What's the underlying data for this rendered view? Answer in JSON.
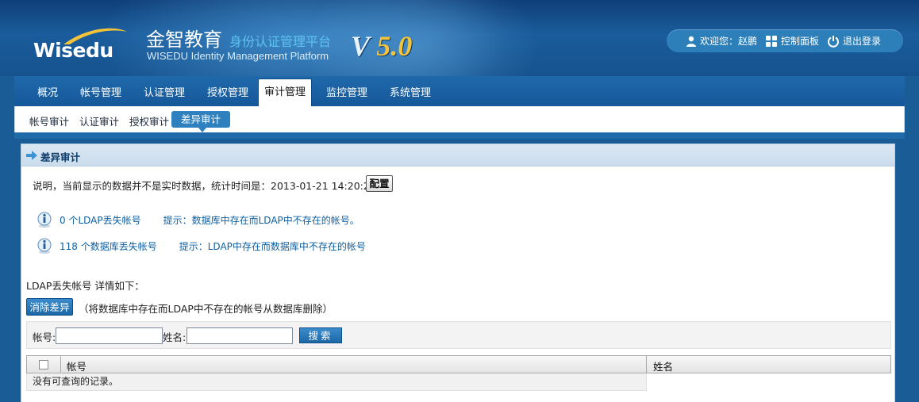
{
  "header": {
    "logo_text": "Wisedu",
    "brand_cn": "金智教育",
    "brand_sub": "身份认证管理平台",
    "brand_en": "WISEDU Identity Management Platform",
    "version_prefix": "V",
    "version_num": "5.0"
  },
  "user_bar": {
    "welcome": "欢迎您：赵鹏",
    "control_panel": "控制面板",
    "logout": "退出登录"
  },
  "nav": {
    "tabs": [
      {
        "label": "概况"
      },
      {
        "label": "帐号管理"
      },
      {
        "label": "认证管理"
      },
      {
        "label": "授权管理"
      },
      {
        "label": "审计管理",
        "active": true
      },
      {
        "label": "监控管理"
      },
      {
        "label": "系统管理"
      }
    ]
  },
  "subnav": {
    "tabs": [
      {
        "label": "帐号审计"
      },
      {
        "label": "认证审计"
      },
      {
        "label": "授权审计"
      },
      {
        "label": "差异审计",
        "active": true
      }
    ]
  },
  "panel": {
    "title": "差异审计",
    "description": "说明，当前显示的数据并不是实时数据，统计时间是：2013-01-21 14:20:23",
    "config_label": "配置",
    "info": [
      {
        "link": "0 个LDAP丢失帐号",
        "hint": "提示：数据库中存在而LDAP中不存在的帐号。"
      },
      {
        "link": "118 个数据库丢失帐号",
        "hint": "提示：LDAP中存在而数据库中不存在的帐号"
      }
    ],
    "section_label": "LDAP丢失帐号 详情如下：",
    "clear_label": "消除差异",
    "clear_note": "（将数据库中存在而LDAP中不存在的帐号从数据库删除）"
  },
  "search": {
    "account_label": "帐号:",
    "account_value": "",
    "name_label": "姓名:",
    "name_value": "",
    "button_label": "搜索"
  },
  "grid": {
    "columns": [
      "帐号",
      "姓名"
    ],
    "empty_text": "没有可查询的记录。"
  },
  "colors": {
    "primary": "#1a5c95",
    "accent_blue": "#2f80bf",
    "gold": "#f3c33a",
    "link": "#0e5fa1"
  }
}
